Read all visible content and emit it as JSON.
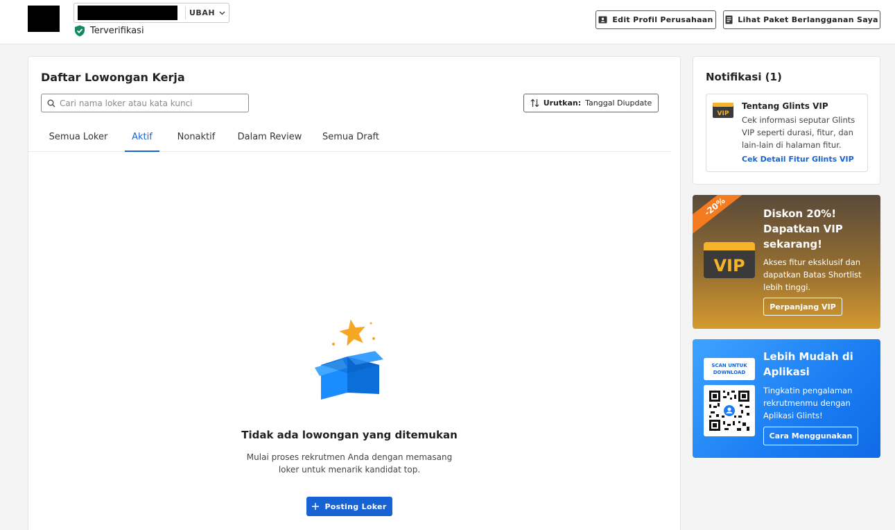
{
  "header": {
    "company_action": "UBAH",
    "verified_label": "Terverifikasi",
    "edit_profile_label": "Edit Profil Perusahaan",
    "view_plan_label": "Lihat Paket Berlangganan Saya"
  },
  "jobs": {
    "title": "Daftar Lowongan Kerja",
    "search_placeholder": "Cari nama loker atau kata kunci",
    "sort_label": "Urutkan:",
    "sort_value": "Tanggal Diupdate",
    "tabs": [
      {
        "label": "Semua Loker"
      },
      {
        "label": "Aktif"
      },
      {
        "label": "Nonaktif"
      },
      {
        "label": "Dalam Review"
      },
      {
        "label": "Semua Draft"
      }
    ],
    "active_tab": "Aktif",
    "empty_title": "Tidak ada lowongan yang ditemukan",
    "empty_desc_line1": "Mulai proses rekrutmen Anda dengan memasang",
    "empty_desc_line2": "loker untuk menarik kandidat top.",
    "post_button": "Posting Loker"
  },
  "notifications": {
    "title": "Notifikasi (1)",
    "item": {
      "icon_text": "VIP",
      "title": "Tentang Glints VIP",
      "body": "Cek informasi seputar Glints VIP seperti durasi, fitur, dan lain-lain di halaman fitur.",
      "link": "Cek Detail Fitur Glints VIP"
    }
  },
  "promo": {
    "ribbon": "-20%",
    "badge": "VIP",
    "title": "Diskon 20%! Dapatkan VIP sekarang!",
    "body": "Akses fitur eksklusif dan dapatkan Batas Shortlist lebih tinggi.",
    "button": "Perpanjang VIP",
    "colors": {
      "ribbon": "#f47b20",
      "badge": "#f5b32a"
    }
  },
  "app_promo": {
    "scan_label": "SCAN UNTUK DOWNLOAD",
    "title": "Lebih Mudah di Aplikasi",
    "body": "Tingkatin pengalaman rekrutmenmu dengan Aplikasi Glints!",
    "button": "Cara Menggunakan"
  },
  "colors": {
    "accent": "#1763d3",
    "verified": "#12895c"
  }
}
